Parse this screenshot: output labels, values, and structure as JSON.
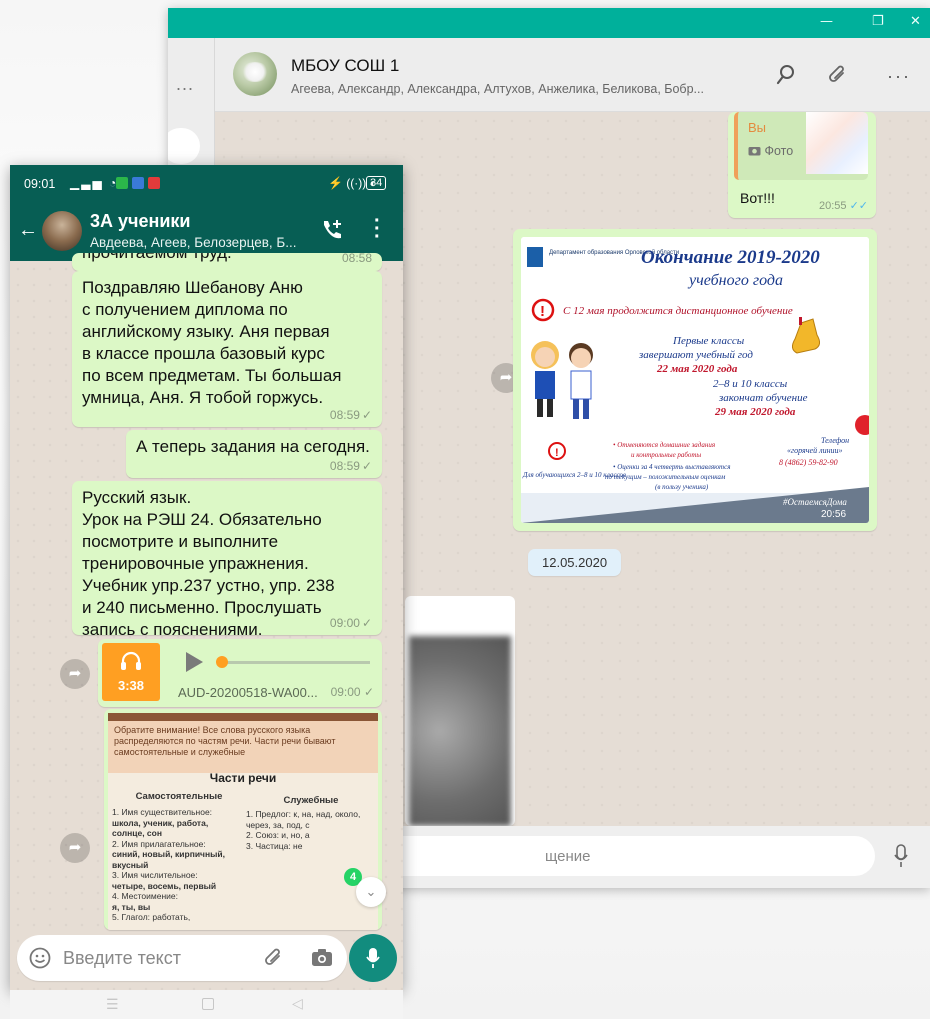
{
  "desktop": {
    "window_controls": [
      "—",
      "❐",
      "✕"
    ],
    "left_menu": "...",
    "header": {
      "title": "МБОУ СОШ  1",
      "participants": "Агеева, Александр, Александра, Алтухов, Анжелика, Беликова, Бобр..."
    },
    "reply_message": {
      "quote_name": "Вы",
      "quote_label": "Фото",
      "text": "Вот!!!",
      "time": "20:55"
    },
    "poster": {
      "org": "Департамент образования Орловской области",
      "title_line1": "Окончание 2019-2020",
      "title_line2": "учебного года",
      "lead": "С 12 мая продолжится дистанционное обучение",
      "first_classes_1": "Первые классы",
      "first_classes_2": "завершают учебный год",
      "first_classes_date": "22 мая 2020 года",
      "grades_1": "2–8 и 10 классы",
      "grades_2": "закончат обучение",
      "grades_date": "29 мая 2020 года",
      "students_note": "Для обучающихся 2–8 и 10 классов",
      "bullet_1": "•  Отменяются домашние задания",
      "bullet_1b": "и контрольные работы",
      "bullet_2": "•  Оценки за 4 четверть выставляются",
      "bullet_2b": "по текущим – положительным оценкам",
      "bullet_2c": "(в пользу ученика)",
      "phone_label": "Телефон",
      "phone_sub": "«горячей линии»",
      "phone_number": "8 (4862) 59-82-90",
      "hashtag": "#ОстаемсяДома",
      "time": "20:56"
    },
    "date_chip": "12.05.2020",
    "composer_placeholder": "щение"
  },
  "phone": {
    "status": {
      "time": "09:01",
      "battery": "34"
    },
    "chat_title": "3А ученики",
    "chat_participants": "Авдеева, Агеев, Белозерцев, Б...",
    "partial_top_text": "прочитаемом труд.",
    "partial_top_time": "08:58",
    "messages": [
      {
        "text": "Поздравляю Шебанову Аню\nс получением диплома по\nанглийскому языку. Аня первая\nв классе прошла базовый курс\nпо всем предметам. Ты большая\nумница, Аня. Я тобой горжусь.",
        "time": "08:59"
      },
      {
        "text": "А теперь задания на сегодня.",
        "time": "08:59"
      },
      {
        "text": "Русский язык.\nУрок на РЭШ 24. Обязательно\nпосмотрите и выполните\nтренировочные упражнения.\nУчебник упр.237 устно, упр. 238\nи 240 письменно. Прослушать\nзапись с пояснениями.",
        "time": "09:00"
      }
    ],
    "audio": {
      "duration": "3:38",
      "filename": "AUD-20200518-WA00...",
      "time": "09:00"
    },
    "textbook": {
      "banner": "Обратите внимание! Все слова русского языка распределяются по частям речи. Части речи бывают самостоятельные и служебные",
      "title": "Части речи",
      "col1_head": "Самостоятельные",
      "col2_head": "Служебные",
      "col1": [
        "1. Имя существительное:",
        "школа, ученик, работа, солнце, сон",
        "2. Имя прилагательное:",
        "синий, новый, кирпичный, вкусный",
        "3. Имя числительное:",
        "четыре, восемь, первый",
        "4. Местоимение:",
        "я, ты, вы",
        "5. Глагол: работать,"
      ],
      "col2": [
        "1. Предлог: к, на, над, около, через, за, под, с",
        "2. Союз: и, но, а",
        "3. Частица: не"
      ]
    },
    "unread_badge": "4",
    "composer_placeholder": "Введите текст"
  }
}
